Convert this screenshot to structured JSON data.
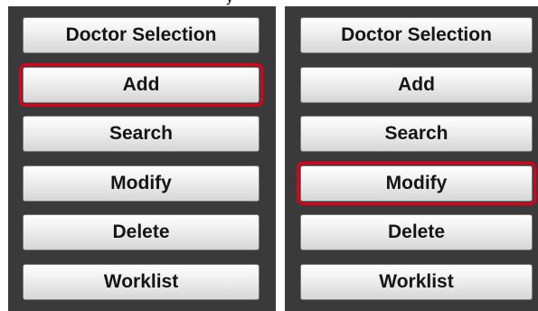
{
  "top_text": "y",
  "panels": [
    {
      "buttons": [
        {
          "label": "Doctor Selection",
          "highlighted": false
        },
        {
          "label": "Add",
          "highlighted": true
        },
        {
          "label": "Search",
          "highlighted": false
        },
        {
          "label": "Modify",
          "highlighted": false
        },
        {
          "label": "Delete",
          "highlighted": false
        },
        {
          "label": "Worklist",
          "highlighted": false
        }
      ]
    },
    {
      "buttons": [
        {
          "label": "Doctor Selection",
          "highlighted": false
        },
        {
          "label": "Add",
          "highlighted": false
        },
        {
          "label": "Search",
          "highlighted": false
        },
        {
          "label": "Modify",
          "highlighted": true
        },
        {
          "label": "Delete",
          "highlighted": false
        },
        {
          "label": "Worklist",
          "highlighted": false
        }
      ]
    }
  ],
  "colors": {
    "panel_background": "#3a3a3a",
    "highlight_border": "#e0001a",
    "button_text": "#151515"
  }
}
